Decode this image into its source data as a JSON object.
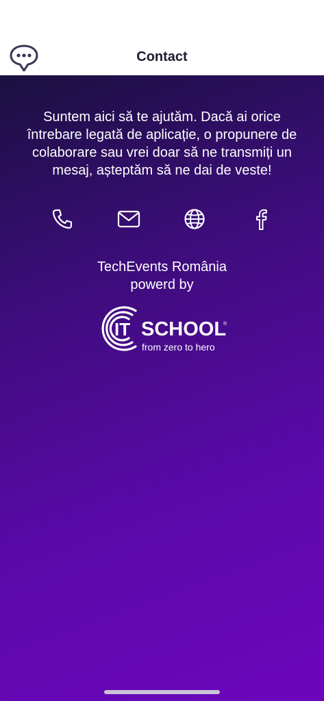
{
  "header": {
    "title": "Contact",
    "logo_icon": "chat-bubble-logo-icon"
  },
  "intro": {
    "text": "Suntem aici să te ajutăm. Dacă ai orice întrebare legată de aplicație, o propunere de colaborare sau vrei doar să ne transmiți un mesaj, așteptăm să ne dai de veste!"
  },
  "contact_icons": [
    {
      "name": "phone-icon"
    },
    {
      "name": "mail-icon"
    },
    {
      "name": "globe-icon"
    },
    {
      "name": "facebook-icon"
    }
  ],
  "brand": {
    "app_name": "TechEvents România",
    "powered_by": "powerd by"
  },
  "partner_logo": {
    "it": "IT",
    "school": "SCHOOL",
    "registered": "®",
    "tagline": "from zero to hero"
  },
  "colors": {
    "header_bg": "#ffffff",
    "gradient_top": "#1a1040",
    "gradient_bottom": "#6c06bd",
    "text": "#ffffff",
    "logo_stroke": "#3a3557"
  }
}
